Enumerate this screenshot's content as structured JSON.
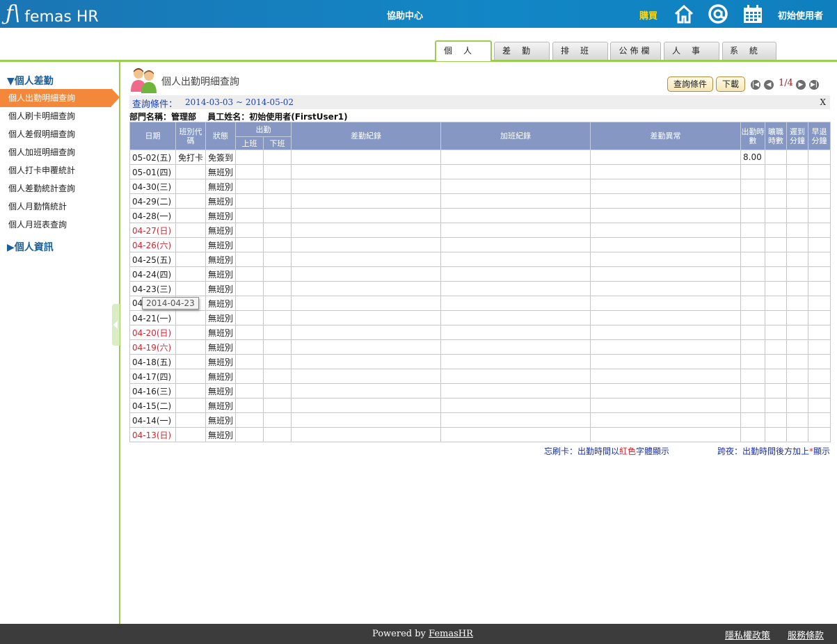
{
  "header": {
    "logo_text": "femas HR",
    "help_center": "協助中心",
    "purchase": "購買",
    "user_name": "初始使用者",
    "icons": [
      "home-icon",
      "at-icon",
      "calendar-icon"
    ]
  },
  "tabs": [
    {
      "label": "個人",
      "active": true
    },
    {
      "label": "差勤",
      "active": false
    },
    {
      "label": "排班",
      "active": false
    },
    {
      "label": "公佈欄",
      "active": false
    },
    {
      "label": "人事",
      "active": false
    },
    {
      "label": "系統",
      "active": false
    }
  ],
  "sidebar": {
    "section1": "▼個人差勤",
    "items": [
      "個人出勤明細查詢",
      "個人刷卡明細查詢",
      "個人差假明細查詢",
      "個人加班明細查詢",
      "個人打卡申覆統計",
      "個人差勤統計查詢",
      "個人月勤惰統計",
      "個人月班表查詢"
    ],
    "section2": "▶個人資訊"
  },
  "main": {
    "title": "個人出勤明細查詢",
    "query_button": "查詢條件",
    "download_button": "下載",
    "pagination": "1/4",
    "cond_label": "查詢條件：",
    "cond_value": "2014-03-03 ~ 2014-05-02",
    "cond_close": "X",
    "dept": "部門名稱：管理部",
    "employee": "員工姓名：初始使用者(FirstUser1)",
    "tooltip": "2014-04-23"
  },
  "table": {
    "headers": {
      "date": "日期",
      "shift": "班別代碼",
      "status": "狀態",
      "attend": "出勤",
      "on": "上班",
      "off": "下班",
      "record": "差勤紀錄",
      "overtime": "加班紀錄",
      "abnormal": "差勤異常",
      "hours": "出勤時數",
      "absent": "曠職時數",
      "late": "遲到分鐘",
      "early": "早退分鐘"
    },
    "rows": [
      {
        "date": "05-02(五)",
        "red": false,
        "shift": "免打卡",
        "status": "免簽到",
        "hours": "8.00"
      },
      {
        "date": "05-01(四)",
        "red": false,
        "shift": "",
        "status": "無班別",
        "hours": ""
      },
      {
        "date": "04-30(三)",
        "red": false,
        "shift": "",
        "status": "無班別",
        "hours": ""
      },
      {
        "date": "04-29(二)",
        "red": false,
        "shift": "",
        "status": "無班別",
        "hours": ""
      },
      {
        "date": "04-28(一)",
        "red": false,
        "shift": "",
        "status": "無班別",
        "hours": ""
      },
      {
        "date": "04-27(日)",
        "red": true,
        "shift": "",
        "status": "無班別",
        "hours": ""
      },
      {
        "date": "04-26(六)",
        "red": true,
        "shift": "",
        "status": "無班別",
        "hours": ""
      },
      {
        "date": "04-25(五)",
        "red": false,
        "shift": "",
        "status": "無班別",
        "hours": ""
      },
      {
        "date": "04-24(四)",
        "red": false,
        "shift": "",
        "status": "無班別",
        "hours": ""
      },
      {
        "date": "04-23(三)",
        "red": false,
        "shift": "",
        "status": "無班別",
        "hours": ""
      },
      {
        "date": "04",
        "red": false,
        "shift": "",
        "status": "無班別",
        "hours": ""
      },
      {
        "date": "04-21(一)",
        "red": false,
        "shift": "",
        "status": "無班別",
        "hours": ""
      },
      {
        "date": "04-20(日)",
        "red": true,
        "shift": "",
        "status": "無班別",
        "hours": ""
      },
      {
        "date": "04-19(六)",
        "red": true,
        "shift": "",
        "status": "無班別",
        "hours": ""
      },
      {
        "date": "04-18(五)",
        "red": false,
        "shift": "",
        "status": "無班別",
        "hours": ""
      },
      {
        "date": "04-17(四)",
        "red": false,
        "shift": "",
        "status": "無班別",
        "hours": ""
      },
      {
        "date": "04-16(三)",
        "red": false,
        "shift": "",
        "status": "無班別",
        "hours": ""
      },
      {
        "date": "04-15(二)",
        "red": false,
        "shift": "",
        "status": "無班別",
        "hours": ""
      },
      {
        "date": "04-14(一)",
        "red": false,
        "shift": "",
        "status": "無班別",
        "hours": ""
      },
      {
        "date": "04-13(日)",
        "red": true,
        "shift": "",
        "status": "無班別",
        "hours": ""
      }
    ]
  },
  "legend": {
    "left_a": "忘刷卡：出勤時間以",
    "left_red": "紅色",
    "left_b": "字體顯示",
    "right_a": "跨夜：出勤時間後方加上",
    "right_red": "*",
    "right_b": "顯示"
  },
  "footer": {
    "powered_by": "Powered by ",
    "powered_link": "FemasHR",
    "privacy": "隱私權政策",
    "terms": "服務條款"
  },
  "colors": {
    "header_bg": "#1287c6",
    "accent_green": "#9ccc53",
    "sidebar_active": "#f4883a",
    "table_header": "#8597c2",
    "weekend_red": "#e0202a"
  }
}
